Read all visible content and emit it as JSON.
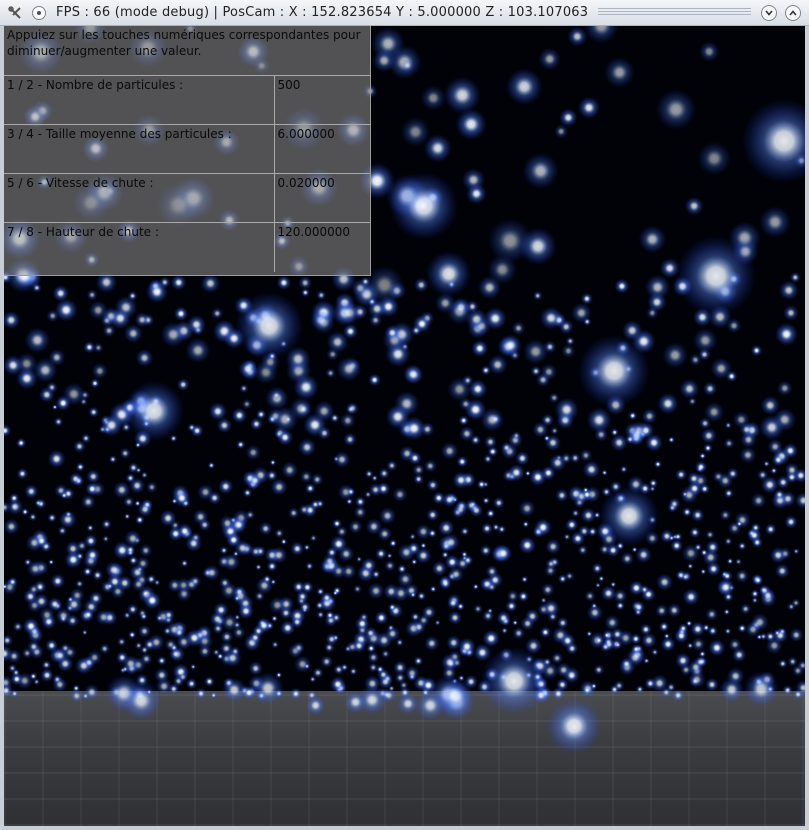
{
  "window": {
    "title": "FPS : 66 (mode debug) |  PosCam :  X : 152.823654 Y : 5.000000 Z : 103.107063",
    "app_icon": "tools-icon",
    "controls": [
      "minimize-icon",
      "maximize-icon"
    ]
  },
  "panel": {
    "instructions": "Appuiez sur les touches numériques correspondantes pour diminuer/augmenter une valeur.",
    "rows": [
      {
        "label": "1 / 2 - Nombre de particules :",
        "value": "500"
      },
      {
        "label": "3 / 4 - Taille moyenne des particules :",
        "value": "6.000000"
      },
      {
        "label": "5 / 6 - Vitesse de chute :",
        "value": "0.020000"
      },
      {
        "label": "7 / 8 - Hauteur de chute :",
        "value": "120.000000"
      }
    ]
  },
  "colors": {
    "particle_core": "#ffffff",
    "particle_glow": "#5c8cff",
    "sky": "#000208",
    "floor": "#3a3c40"
  }
}
